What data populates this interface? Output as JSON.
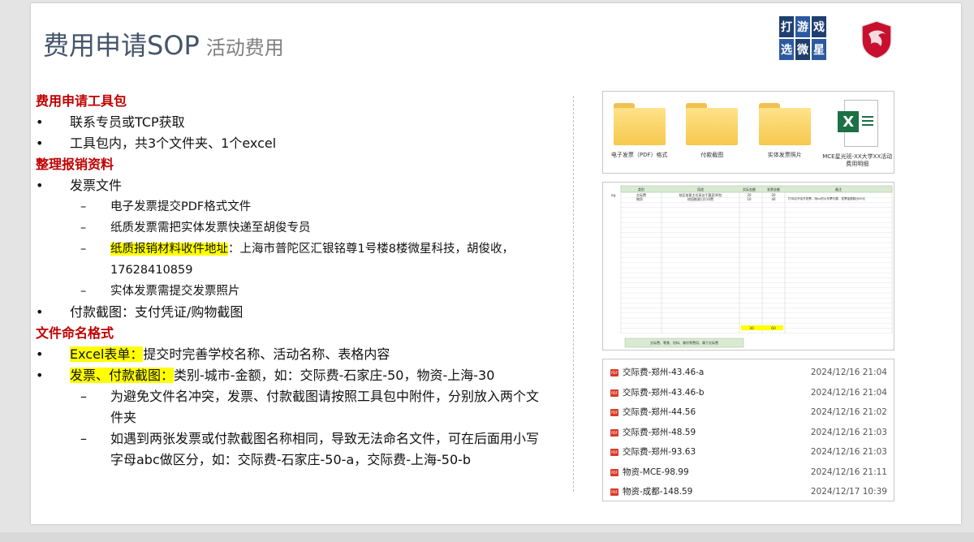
{
  "slide": {
    "title": "费用申请SOP",
    "subtitle": "活动费用",
    "logo_chars": [
      "打",
      "游",
      "戏",
      "选",
      "微",
      "星"
    ]
  },
  "sections": [
    {
      "heading": "费用申请工具包"
    },
    {
      "heading": "整理报销资料"
    },
    {
      "heading": "文件命名格式"
    }
  ],
  "bullets": {
    "toolkit_1": "联系专员或TCP获取",
    "toolkit_2": "工具包内，共3个文件夹、1个excel",
    "invoice": "发票文件",
    "invoice_sub_1": "电子发票提交PDF格式文件",
    "invoice_sub_2": "纸质发票需把实体发票快递至胡俊专员",
    "invoice_sub_3_hl": "纸质报销材料收件地址",
    "invoice_sub_3": "：上海市普陀区汇银铭尊1号楼8楼微星科技，胡俊收，17628410859",
    "invoice_sub_4": "实体发票需提交发票照片",
    "payment": "付款截图：支付凭证/购物截图",
    "naming_1_hl": "Excel表单：",
    "naming_1": "提交时完善学校名称、活动名称、表格内容",
    "naming_2_hl": "发票、付款截图：",
    "naming_2": "类别-城市-金额，如：交际费-石家庄-50，物资-上海-30",
    "naming_sub_1": "为避免文件名冲突，发票、付款截图请按照工具包中附件，分别放入两个文件夹",
    "naming_sub_2": "如遇到两张发票或付款截图名称相同，导致无法命名文件，可在后面用小写字母abc做区分，如：交际费-石家庄-50-a，交际费-上海-50-b"
  },
  "toolkit_files": [
    {
      "label": "电子发票（PDF）格式",
      "icon": "folder-icon"
    },
    {
      "label": "付款截图",
      "icon": "folder-icon"
    },
    {
      "label": "实体发票照片",
      "icon": "folder-icon"
    },
    {
      "label": "MCE星光班-XX大学XX活动费用明细",
      "icon": "excel-icon"
    }
  ],
  "sheet": {
    "headers": [
      "类别",
      "用途",
      "实际金额",
      "发票金额",
      "备注"
    ],
    "row_label": "eg.",
    "rows": [
      {
        "cat": "交际费",
        "use": "校区前星主任采访千篇宣40包",
        "actual": "20",
        "invoice": "20",
        "note": "打印店不给开发票，用xx的火车票代替，发票金额超出30元"
      },
      {
        "cat": "物资",
        "use": "校园推星日打印费",
        "actual": "10",
        "invoice": "40",
        "note": ""
      }
    ],
    "total_actual": "30",
    "total_invoice": "60",
    "footer_note": "交际费、零食、饮料、餐饮等费用、属于交际费"
  },
  "file_list": [
    {
      "name": "交际费-郑州-43.46-a",
      "date": "2024/12/16 21:04"
    },
    {
      "name": "交际费-郑州-43.46-b",
      "date": "2024/12/16 21:04"
    },
    {
      "name": "交际费-郑州-44.56",
      "date": "2024/12/16 21:02"
    },
    {
      "name": "交际费-郑州-48.59",
      "date": "2024/12/16 21:03"
    },
    {
      "name": "交际费-郑州-93.63",
      "date": "2024/12/16 21:03"
    },
    {
      "name": "物资-MCE-98.99",
      "date": "2024/12/16 21:11"
    },
    {
      "name": "物资-成都-148.59",
      "date": "2024/12/17 10:39"
    }
  ],
  "file_icon_text": "PDF",
  "colors": {
    "heading": "#c00000",
    "title": "#44546a",
    "highlight": "#ffff00",
    "sheet_header": "#d9ead3"
  }
}
